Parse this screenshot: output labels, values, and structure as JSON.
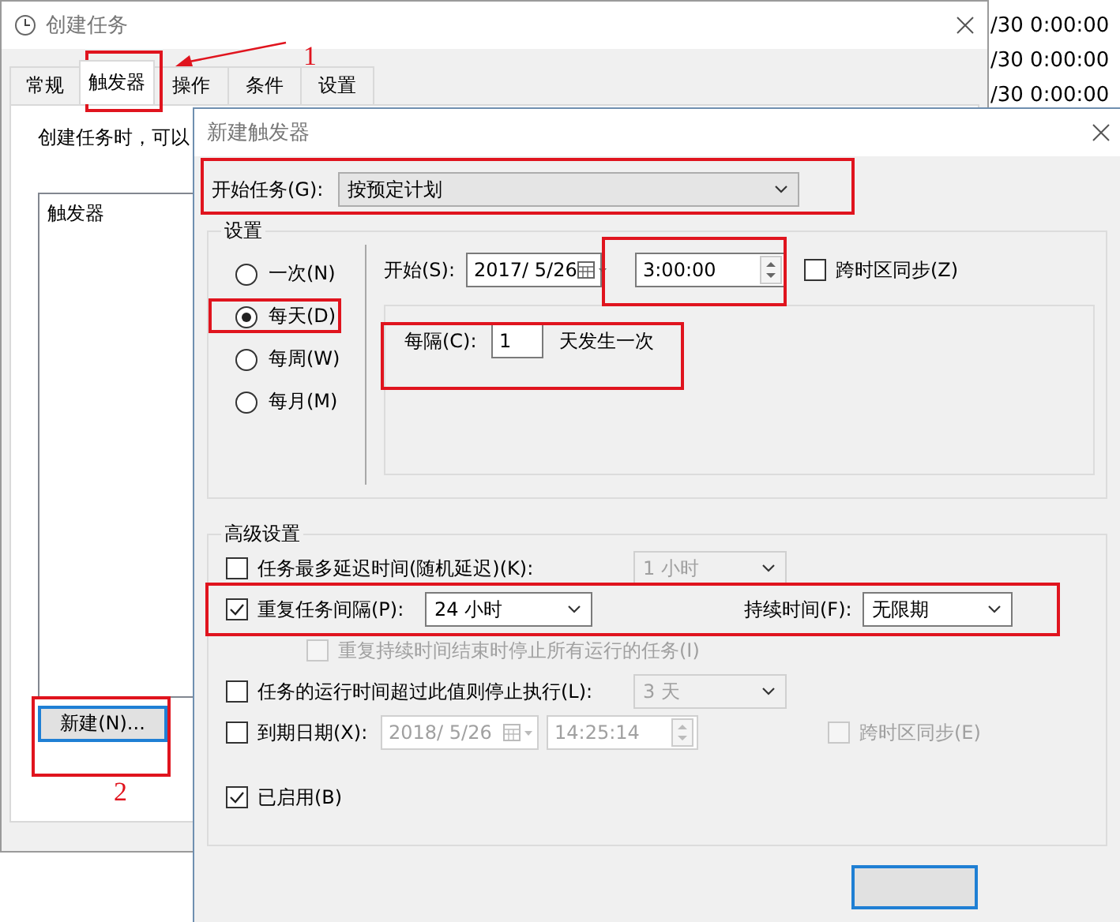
{
  "background_list": {
    "rows": [
      "/30 0:00:00",
      "/30 0:00:00",
      "/30 0:00:00"
    ]
  },
  "task_window": {
    "title": "创建任务",
    "tabs": [
      {
        "label": "常规",
        "selected": false
      },
      {
        "label": "触发器",
        "selected": true
      },
      {
        "label": "操作",
        "selected": false
      },
      {
        "label": "条件",
        "selected": false
      },
      {
        "label": "设置",
        "selected": false
      }
    ],
    "description": "创建任务时，可以",
    "trigger_list": {
      "header": "触发器"
    },
    "new_button": "新建(N)..."
  },
  "trigger_dialog": {
    "title": "新建触发器",
    "begin_task": {
      "label": "开始任务(G):",
      "value": "按预定计划"
    },
    "settings": {
      "title": "设置",
      "schedules": [
        {
          "label": "一次(N)",
          "selected": false
        },
        {
          "label": "每天(D)",
          "selected": true
        },
        {
          "label": "每周(W)",
          "selected": false
        },
        {
          "label": "每月(M)",
          "selected": false
        }
      ],
      "start": {
        "label": "开始(S):",
        "date": "2017/ 5/26",
        "time": "3:00:00",
        "sync": {
          "label": "跨时区同步(Z)",
          "checked": false
        }
      },
      "recur": {
        "label": "每隔(C):",
        "value": "1",
        "unit": "天发生一次"
      }
    },
    "advanced": {
      "title": "高级设置",
      "options": [
        {
          "kind": "dropdown",
          "label": "任务最多延迟时间(随机延迟)(K):",
          "checked": false,
          "value": "1 小时",
          "disabled": true
        },
        {
          "kind": "repeat",
          "label": "重复任务间隔(P):",
          "checked": true,
          "value": "24 小时",
          "duration_label": "持续时间(F):",
          "duration": "无限期"
        },
        {
          "kind": "sub",
          "label": "重复持续时间结束时停止所有运行的任务(I)",
          "checked": false,
          "disabled": true
        },
        {
          "kind": "dropdown",
          "label": "任务的运行时间超过此值则停止执行(L):",
          "checked": false,
          "value": "3 天",
          "disabled": true
        },
        {
          "kind": "expire",
          "label": "到期日期(X):",
          "checked": false,
          "date": "2018/ 5/26",
          "time": "14:25:14",
          "sync_label": "跨时区同步(E)",
          "sync_checked": false,
          "disabled": true
        },
        {
          "kind": "plain",
          "label": "已启用(B)",
          "checked": true
        }
      ]
    }
  },
  "annotations": {
    "labels": [
      "1",
      "2"
    ]
  }
}
